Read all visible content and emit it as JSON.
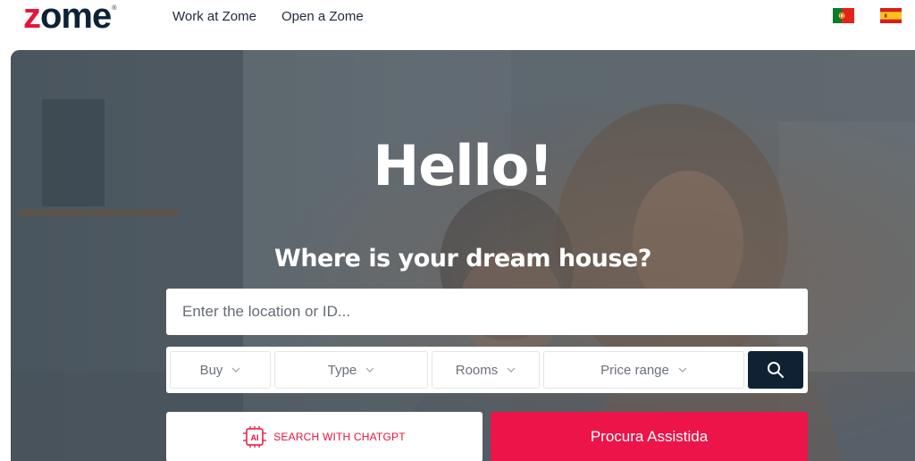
{
  "brand": {
    "logo_first": "z",
    "logo_rest": "ome",
    "registered_mark": "®",
    "accent_color": "#e8143c",
    "dark_color": "#0d2236"
  },
  "nav": {
    "work_label": "Work at Zome",
    "open_label": "Open a Zome"
  },
  "languages": [
    {
      "icon": "portugal-flag-icon"
    },
    {
      "icon": "spain-flag-icon"
    }
  ],
  "hero": {
    "title": "Hello!",
    "subtitle": "Where is your dream house?"
  },
  "search": {
    "placeholder": "Enter the location or ID...",
    "value": ""
  },
  "filters": {
    "buy": "Buy",
    "type": "Type",
    "rooms": "Rooms",
    "price": "Price range"
  },
  "actions": {
    "ai_badge": "AI",
    "ai_label": "SEARCH WITH CHATGPT",
    "assisted_label": "Procura Assistida",
    "assisted_color": "#ec1448",
    "search_button_color": "#0e2233"
  }
}
